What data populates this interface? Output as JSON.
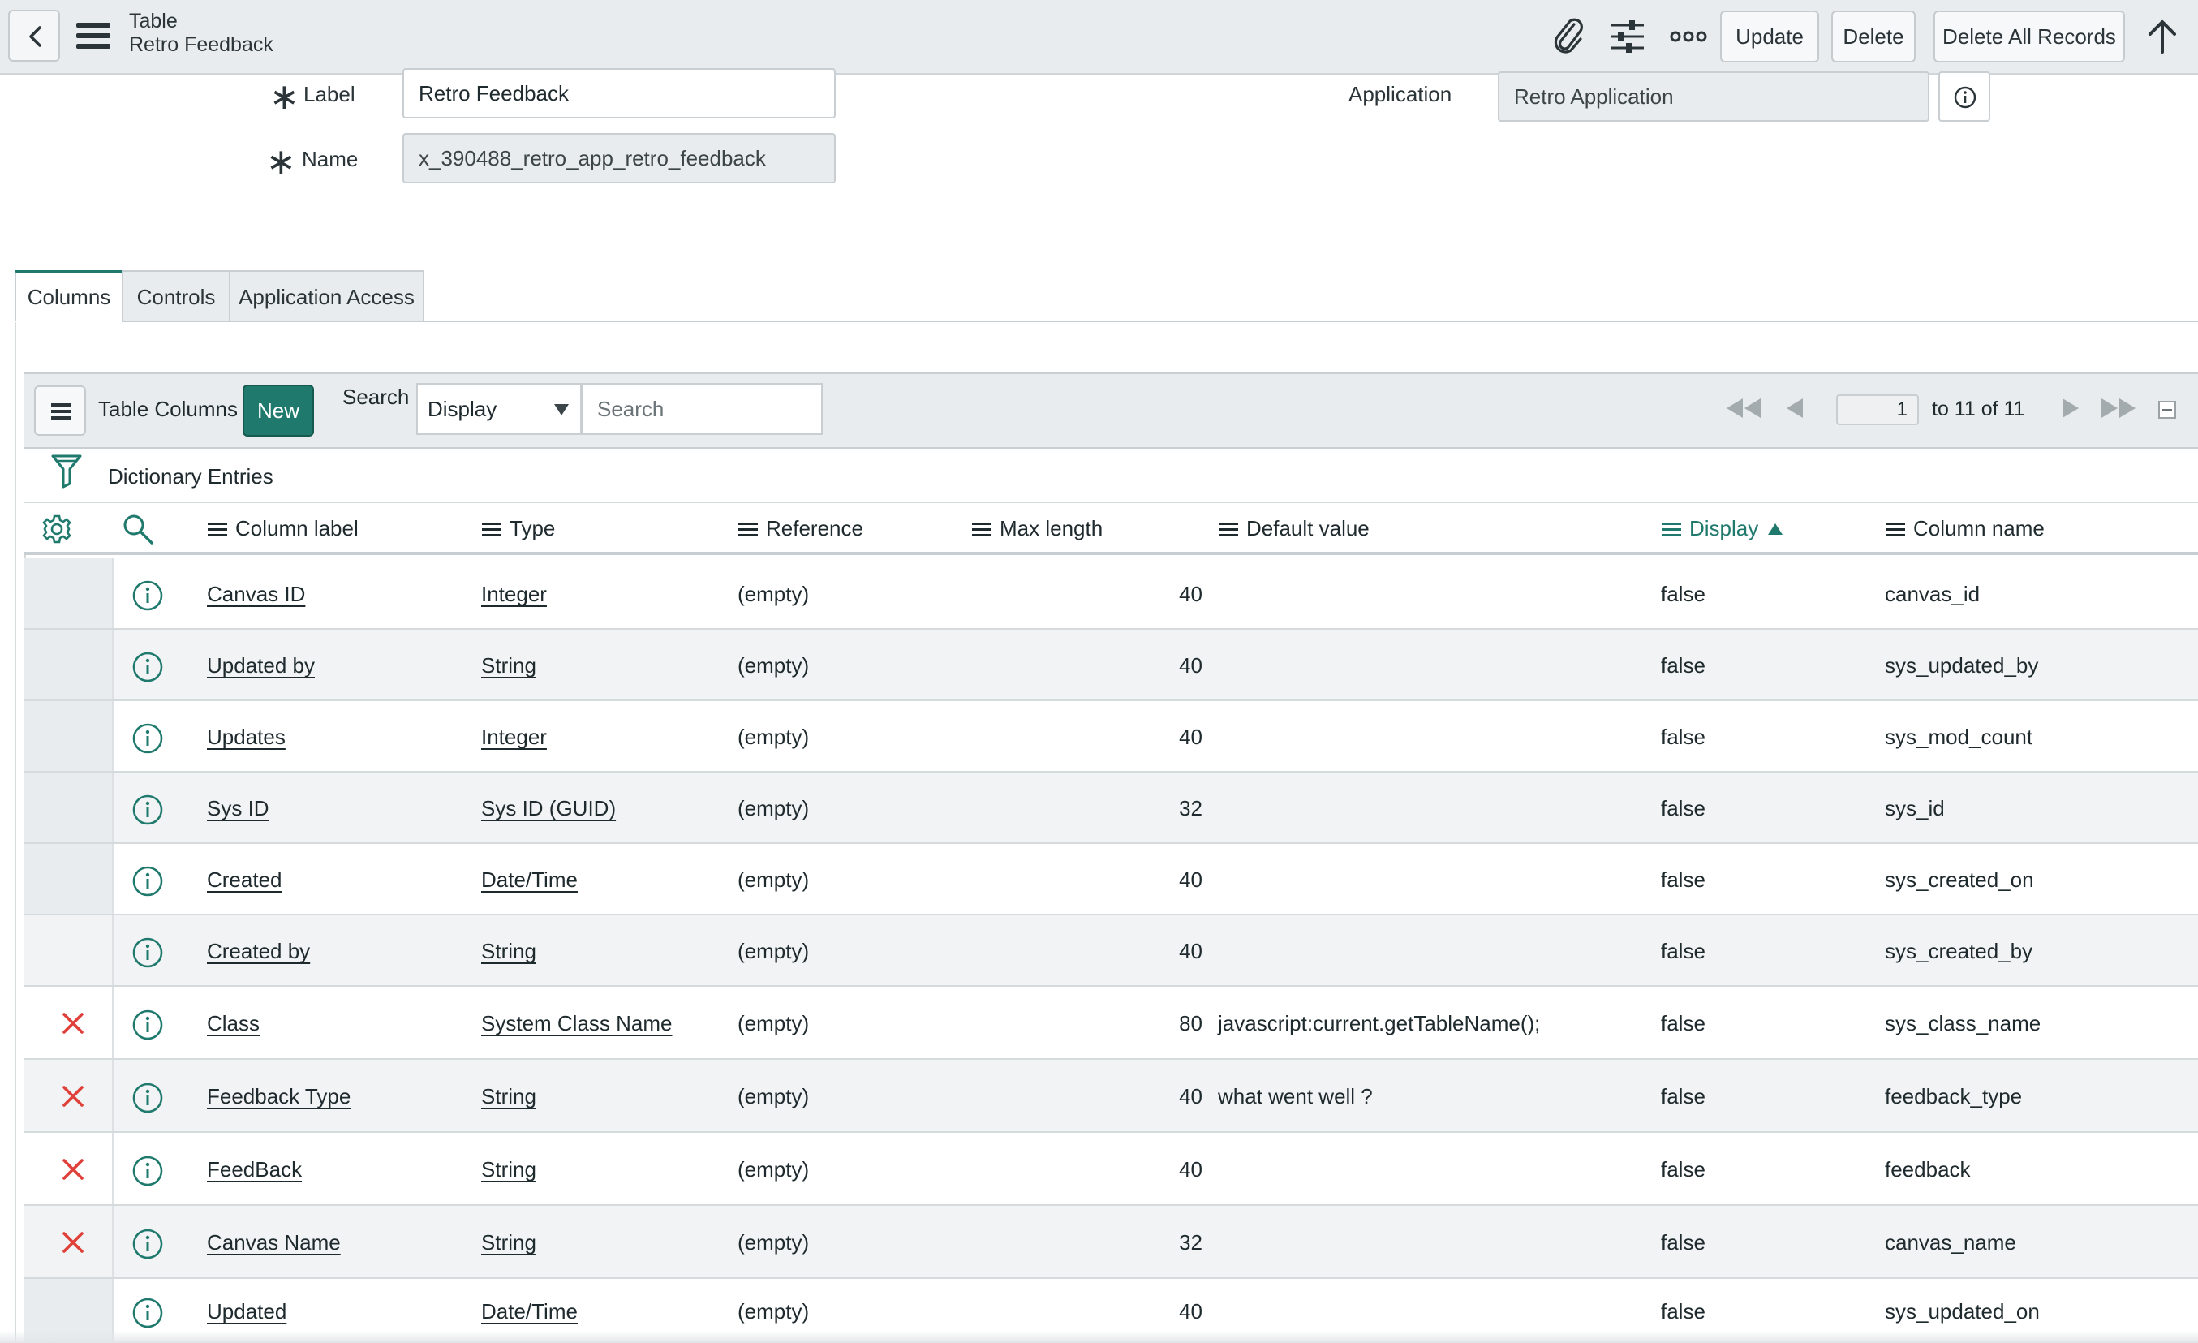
{
  "header": {
    "title": "Table",
    "subtitle": "Retro Feedback",
    "buttons": {
      "update": "Update",
      "delete": "Delete",
      "delete_all": "Delete All Records"
    }
  },
  "form": {
    "label": {
      "label": "Label",
      "value": "Retro Feedback"
    },
    "name": {
      "label": "Name",
      "value": "x_390488_retro_app_retro_feedback"
    },
    "application": {
      "label": "Application",
      "value": "Retro Application"
    }
  },
  "tabs": [
    "Columns",
    "Controls",
    "Application Access"
  ],
  "list": {
    "title": "Table Columns",
    "new_label": "New",
    "search_label": "Search",
    "search_field": "Display",
    "search_placeholder": "Search",
    "page": "1",
    "range": "to 11 of 11",
    "breadcrumb": "Dictionary Entries"
  },
  "columns": [
    "Column label",
    "Type",
    "Reference",
    "Max length",
    "Default value",
    "Display",
    "Column name"
  ],
  "rows": [
    {
      "label": "Canvas ID",
      "type": "Integer",
      "reference": "(empty)",
      "max_length": "40",
      "default": "",
      "display": "false",
      "column": "canvas_id",
      "deletable": false
    },
    {
      "label": "Updated by",
      "type": "String",
      "reference": "(empty)",
      "max_length": "40",
      "default": "",
      "display": "false",
      "column": "sys_updated_by",
      "deletable": false
    },
    {
      "label": "Updates",
      "type": "Integer",
      "reference": "(empty)",
      "max_length": "40",
      "default": "",
      "display": "false",
      "column": "sys_mod_count",
      "deletable": false
    },
    {
      "label": "Sys ID",
      "type": "Sys ID (GUID)",
      "reference": "(empty)",
      "max_length": "32",
      "default": "",
      "display": "false",
      "column": "sys_id",
      "deletable": false
    },
    {
      "label": "Created",
      "type": "Date/Time",
      "reference": "(empty)",
      "max_length": "40",
      "default": "",
      "display": "false",
      "column": "sys_created_on",
      "deletable": false
    },
    {
      "label": "Created by",
      "type": "String",
      "reference": "(empty)",
      "max_length": "40",
      "default": "",
      "display": "false",
      "column": "sys_created_by",
      "deletable": false
    },
    {
      "label": "Class",
      "type": "System Class Name",
      "reference": "(empty)",
      "max_length": "80",
      "default": "javascript:current.getTableName();",
      "display": "false",
      "column": "sys_class_name",
      "deletable": true
    },
    {
      "label": "Feedback Type",
      "type": "String",
      "reference": "(empty)",
      "max_length": "40",
      "default": "what went well ?",
      "display": "false",
      "column": "feedback_type",
      "deletable": true
    },
    {
      "label": "FeedBack",
      "type": "String",
      "reference": "(empty)",
      "max_length": "40",
      "default": "",
      "display": "false",
      "column": "feedback",
      "deletable": true
    },
    {
      "label": "Canvas Name",
      "type": "String",
      "reference": "(empty)",
      "max_length": "32",
      "default": "",
      "display": "false",
      "column": "canvas_name",
      "deletable": true
    },
    {
      "label": "Updated",
      "type": "Date/Time",
      "reference": "(empty)",
      "max_length": "40",
      "default": "",
      "display": "false",
      "column": "sys_updated_on",
      "deletable": false
    }
  ],
  "colors": {
    "accent": "#1f7a6d",
    "delete": "#e0403a",
    "header_bg": "#e9ecee"
  },
  "icons": {
    "header": [
      "back-arrow-icon",
      "hamburger-menu-icon",
      "paperclip-icon",
      "sliders-icon",
      "more-icon",
      "arrow-up-icon"
    ],
    "list": [
      "list-menu-icon",
      "first-page-icon",
      "prev-page-icon",
      "next-page-icon",
      "last-page-icon",
      "collapse-icon",
      "filter-icon",
      "gear-icon",
      "search-icon",
      "info-icon",
      "delete-x-icon"
    ]
  }
}
